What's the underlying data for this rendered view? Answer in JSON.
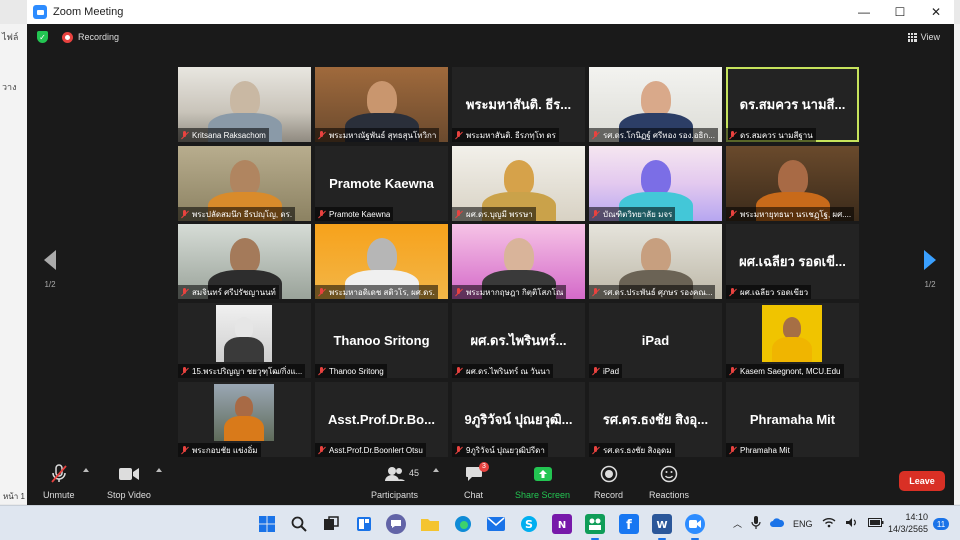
{
  "window": {
    "title": "Zoom Meeting",
    "minimize": "—",
    "maximize": "☐",
    "close": "✕"
  },
  "topbar": {
    "recording": "Recording",
    "view": "View"
  },
  "pager": {
    "left": "1/2",
    "right": "1/2"
  },
  "tiles": [
    {
      "label": "Kritsana Raksachom",
      "name": "",
      "video": true
    },
    {
      "label": "พระมหาณัฐพันธ์ สุทธสุนโทวิกา",
      "name": "",
      "video": true
    },
    {
      "label": "พระมหาสันติ. ธีรภทฺโท ดร",
      "name": "พระมหาสันติ. ธีร...",
      "video": false
    },
    {
      "label": "รศ.ดร.โกนิฏฐ์ ศรีทอง รอง.อธิก...",
      "name": "",
      "video": true
    },
    {
      "label": "ดร.สมควร นามสีฐาน",
      "name": "ดร.สมควร นามสี...",
      "video": false,
      "active": true
    },
    {
      "label": "พระปลัดสมนึก ธีรปญฺโญ, ดร.",
      "name": "",
      "video": true
    },
    {
      "label": "Pramote Kaewna",
      "name": "Pramote Kaewna",
      "video": false
    },
    {
      "label": "ผศ.ดร.บุญมี พรรษา",
      "name": "",
      "video": true
    },
    {
      "label": "บัณฑิตวิทยาลัย มจร",
      "name": "",
      "video": true
    },
    {
      "label": "พระมหายุทธนา นรเชฏฺโฐ, ผศ....",
      "name": "",
      "video": true
    },
    {
      "label": "สมจินทร์ ศรีปรัชญานนท์",
      "name": "",
      "video": true
    },
    {
      "label": "พระมหาอดิเดช สติวโร, ผศ.ดร.",
      "name": "",
      "video": true
    },
    {
      "label": "พระมหากฤษฎา กิตฺติโสภโณ",
      "name": "",
      "video": true
    },
    {
      "label": "รศ.ดร.ประพันธ์ ศุภษร รองคณ...",
      "name": "",
      "video": true
    },
    {
      "label": "ผศ.เฉลียว รอดเขียว",
      "name": "ผศ.เฉลียว รอดเขี...",
      "video": false
    },
    {
      "label": "15.พระปริญญา ชยวุฑฺโฒ/กิ่งแ...",
      "name": "",
      "video": true
    },
    {
      "label": "Thanoo Sritong",
      "name": "Thanoo Sritong",
      "video": false
    },
    {
      "label": "ผศ.ดร.ไพรินทร์ ณ วันนา",
      "name": "ผศ.ดร.ไพรินทร์...",
      "video": false
    },
    {
      "label": "iPad",
      "name": "iPad",
      "video": false
    },
    {
      "label": "Kasem Saegnont, MCU.Edu",
      "name": "",
      "video": true
    },
    {
      "label": "พระกอบชัย แข่งอิ่ม",
      "name": "",
      "video": true
    },
    {
      "label": "Asst.Prof.Dr.Boonlert Otsu",
      "name": "Asst.Prof.Dr.Bo...",
      "video": false
    },
    {
      "label": "9ภูริวัจน์ ปุณยวุฒิปรีดา",
      "name": "9ภูริวัจน์ ปุณยวุฒิ...",
      "video": false
    },
    {
      "label": "รศ.ดร.ธงชัย สิงอุดม",
      "name": "รศ.ดร.ธงชัย สิงอุ...",
      "video": false
    },
    {
      "label": "Phramaha Mit",
      "name": "Phramaha Mit",
      "video": false
    }
  ],
  "toolbar": {
    "unmute": "Unmute",
    "stop_video": "Stop Video",
    "participants": "Participants",
    "participants_count": "45",
    "chat": "Chat",
    "chat_badge": "3",
    "share_screen": "Share Screen",
    "record": "Record",
    "reactions": "Reactions",
    "leave": "Leave"
  },
  "background_app": {
    "left_text_1": "ไฟล์",
    "left_text_2": "วาง",
    "status": "หน้า 1"
  },
  "taskbar": {
    "lang": "ENG",
    "time": "14:10",
    "date": "14/3/2565",
    "notifications": "11"
  },
  "colors": {
    "accent": "#2d8cff",
    "leave": "#d93025",
    "share": "#23c552",
    "active_speaker": "#c6e35c"
  }
}
